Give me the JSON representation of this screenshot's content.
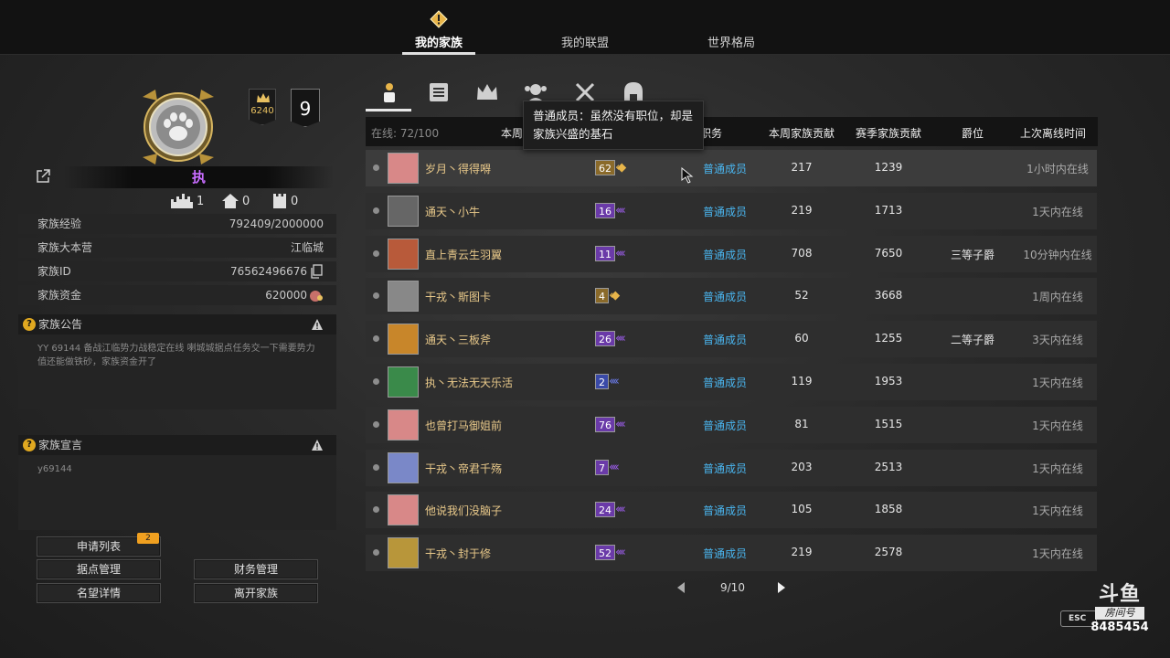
{
  "fps": "58",
  "nav": {
    "tabs": [
      {
        "label": "我的家族",
        "active": true
      },
      {
        "label": "我的联盟",
        "active": false
      },
      {
        "label": "世界格局",
        "active": false
      }
    ]
  },
  "family": {
    "rank_score": "6240",
    "level": "9",
    "name": "执",
    "counts": [
      "1",
      "0",
      "0"
    ],
    "info": [
      {
        "key": "家族经验",
        "value": "792409/2000000"
      },
      {
        "key": "家族大本营",
        "value": "江临城"
      },
      {
        "key": "家族ID",
        "value": "76562496676"
      },
      {
        "key": "家族资金",
        "value": "620000"
      }
    ],
    "announcement": {
      "title": "家族公告",
      "text": "YY 69144 备战江临势力战稳定在线 喇城城据点任务交一下需要势力值还能做铁砂，家族资金开了"
    },
    "declaration": {
      "title": "家族宣言",
      "text": "y69144"
    }
  },
  "buttons": {
    "apply_list": "申请列表",
    "apply_count": "2",
    "stronghold": "据点管理",
    "finance": "财务管理",
    "reputation": "名望详情",
    "leave": "离开家族"
  },
  "table": {
    "online": "在线: 72/100",
    "headers": {
      "week": "本周",
      "duty": "职务",
      "week_contrib": "本周家族贡献",
      "season_contrib": "赛季家族贡献",
      "title": "爵位",
      "last_online": "上次离线时间"
    },
    "tooltip": "普通成员：虽然没有职位，却是家族兴盛的基石",
    "rows": [
      {
        "name": "岁月丶得得嘚",
        "level": "62",
        "tier": "gold",
        "role": "普通成员",
        "week": "217",
        "season": "1239",
        "title": "",
        "last": "1小时内在线"
      },
      {
        "name": "通天丶小牛",
        "level": "16",
        "tier": "purple",
        "role": "普通成员",
        "week": "219",
        "season": "1713",
        "title": "",
        "last": "1天内在线"
      },
      {
        "name": "直上青云生羽翼",
        "level": "11",
        "tier": "purple",
        "role": "普通成员",
        "week": "708",
        "season": "7650",
        "title": "三等子爵",
        "last": "10分钟内在线"
      },
      {
        "name": "干戎丶斯图卡",
        "level": "4",
        "tier": "gold",
        "role": "普通成员",
        "week": "52",
        "season": "3668",
        "title": "",
        "last": "1周内在线"
      },
      {
        "name": "通天丶三板斧",
        "level": "26",
        "tier": "purple",
        "role": "普通成员",
        "week": "60",
        "season": "1255",
        "title": "二等子爵",
        "last": "3天内在线"
      },
      {
        "name": "执丶无法无天乐活",
        "level": "2",
        "tier": "blue",
        "role": "普通成员",
        "week": "119",
        "season": "1953",
        "title": "",
        "last": "1天内在线"
      },
      {
        "name": "也曾打马御姐前",
        "level": "76",
        "tier": "purple",
        "role": "普通成员",
        "week": "81",
        "season": "1515",
        "title": "",
        "last": "1天内在线"
      },
      {
        "name": "干戎丶帝君千殇",
        "level": "7",
        "tier": "purple",
        "role": "普通成员",
        "week": "203",
        "season": "2513",
        "title": "",
        "last": "1天内在线"
      },
      {
        "name": "他说我们没脑子",
        "level": "24",
        "tier": "purple",
        "role": "普通成员",
        "week": "105",
        "season": "1858",
        "title": "",
        "last": "1天内在线"
      },
      {
        "name": "干戎丶封于修",
        "level": "52",
        "tier": "purple",
        "role": "普通成员",
        "week": "219",
        "season": "2578",
        "title": "",
        "last": "1天内在线"
      }
    ]
  },
  "pager": {
    "text": "9/10"
  },
  "overlay": {
    "esc": "ESC",
    "douyu_logo": "斗鱼",
    "room_label": "房间号",
    "room_number": "8485454"
  },
  "colors": {
    "accent_name": "#c86cff",
    "member_name": "#e9c98a",
    "role_blue": "#4ab6f0",
    "tier_gold": "#c8963a",
    "tier_purple": "#8a4cd8",
    "tier_blue": "#4a6ad8"
  }
}
